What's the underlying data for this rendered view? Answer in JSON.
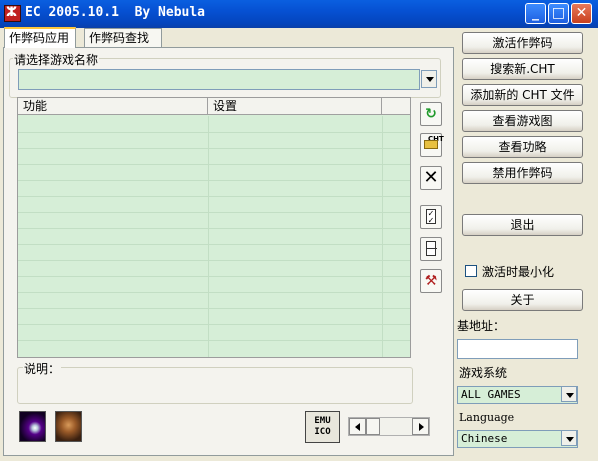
{
  "window": {
    "title": "EC 2005.10.1  By Nebula"
  },
  "caption_buttons": {
    "minimize": "_",
    "maximize": "□",
    "close": "✕"
  },
  "tabs": [
    {
      "label": "作弊码应用",
      "active": true
    },
    {
      "label": "作弊码查找",
      "active": false
    }
  ],
  "game_select": {
    "label": "请选择游戏名称",
    "value": ""
  },
  "cheat_grid": {
    "columns": [
      "功能",
      "设置"
    ],
    "rows": []
  },
  "description": {
    "label": "说明："
  },
  "toolbar": {
    "icons": [
      "refresh-icon",
      "open-cht-icon",
      "delete-icon",
      "check-list-icon",
      "blank-list-icon",
      "tools-icon"
    ],
    "cht_label": "CHT"
  },
  "bottom": {
    "emu_label_top": "EMU",
    "emu_label_bottom": "ICO"
  },
  "right_panel": {
    "buttons": [
      "激活作弊码",
      "搜索新.CHT",
      "添加新的 CHT 文件",
      "查看游戏图",
      "查看功略",
      "禁用作弊码"
    ],
    "exit": "退出",
    "minimize_on_activate": {
      "label": "激活时最小化",
      "checked": false
    },
    "about": "关于",
    "base_address": {
      "label": "基地址：",
      "value": ""
    },
    "game_system": {
      "label": "游戏系统",
      "value": "ALL GAMES"
    },
    "language": {
      "label": "Language",
      "value": "Chinese"
    }
  },
  "colors": {
    "title_bar": "#0650D2",
    "list_bg": "#D6EED7",
    "window_bg": "#ECE9D8"
  }
}
